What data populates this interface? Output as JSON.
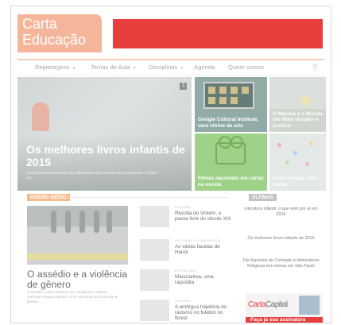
{
  "site": {
    "logo_line1": "Carta",
    "logo_line2": "Educação"
  },
  "nav": {
    "items": [
      "Reportagens",
      "Temas de Aula",
      "Disciplinas",
      "Agenda",
      "Quem somos"
    ],
    "search_icon": "search-icon"
  },
  "hero": {
    "counter": "3",
    "title": "Os melhores livros infantis de 2015",
    "subtitle": "Confira uma lista elaborada por especialistas dos melhores títulos publicados no último ano"
  },
  "tiles": [
    {
      "caption": "Google Cultural Institute, uma vitrine de arte"
    },
    {
      "caption": "O Menino e o Mundo, um filme simples e poético"
    },
    {
      "caption": "Filmes nacionais em cartaz na escola"
    },
    {
      "caption": "Como elogiar sem mimar"
    }
  ],
  "sections": {
    "left_badge": "ENSINO MÉDIO",
    "right_badge": "ÚLTIMAS"
  },
  "feature": {
    "title": "O assédio e a violência de gênero",
    "subtitle": "O assédio contra mulheres em transportes coletivos reafirma o espaço público como reprodutor da violência de gênero"
  },
  "mid_list": [
    {
      "category": "HISTÓRIA",
      "headline": "Revolta do Vintém, o passe livre do século XIX"
    },
    {
      "category": "HISTÓRIAS DA HUMANIDADE",
      "headline": "As várias facetas de Hanói"
    },
    {
      "category": "LITERATURA",
      "headline": "Macunaíma, uma rapsódia"
    },
    {
      "category": "HISTÓRIA",
      "headline": "A ambígua trajetória do racismo no futebol no Brasil"
    }
  ],
  "latest": [
    "Literatura infantil: o que vem por aí em 2016",
    "Os melhores livros infantis de 2015",
    "Dia Nacional de Combate à Intolerância Religiosa tem shows em São Paulo"
  ],
  "ad": {
    "brand_red": "Carta",
    "brand_gray": "Capital",
    "cta": "Faça já sua assinatura"
  },
  "colors": {
    "brand": "#e31d1d",
    "logo": "#f4a98a",
    "accent": "#f6b17b"
  }
}
